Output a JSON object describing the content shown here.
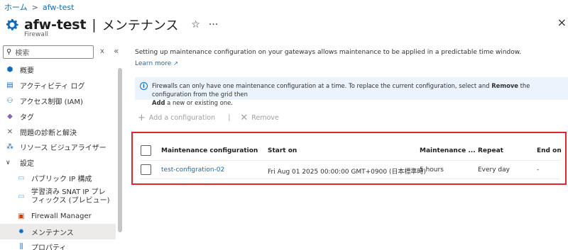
{
  "breadcrumb": {
    "home": "ホーム",
    "current": "afw-test"
  },
  "header": {
    "title": "afw-test",
    "separator": "|",
    "page": "メンテナンス",
    "resource_type": "Firewall",
    "favorite_icon": "☆",
    "more_icon": "···",
    "close_icon": "×"
  },
  "sidebar": {
    "search_placeholder": "検索",
    "clear": "x",
    "collapse": "«",
    "items": [
      {
        "label": "概要",
        "icon": "overview-icon"
      },
      {
        "label": "アクティビティ ログ",
        "icon": "activity-log-icon"
      },
      {
        "label": "アクセス制御 (IAM)",
        "icon": "iam-icon"
      },
      {
        "label": "タグ",
        "icon": "tag-icon"
      },
      {
        "label": "問題の診断と解決",
        "icon": "diagnose-icon"
      },
      {
        "label": "リソース ビジュアライザー",
        "icon": "visualizer-icon"
      },
      {
        "label": "設定",
        "icon": "chevron-down-icon"
      },
      {
        "label": "パブリック IP 構成",
        "icon": "public-ip-icon"
      },
      {
        "label": "学習済み SNAT IP プレフィックス (プレビュー)",
        "icon": "snat-icon"
      },
      {
        "label": "Firewall Manager",
        "icon": "firewall-manager-icon"
      },
      {
        "label": "メンテナンス",
        "icon": "gear-icon"
      },
      {
        "label": "プロパティ",
        "icon": "properties-icon"
      }
    ]
  },
  "main": {
    "description": "Setting up maintenance configuration on your gateways allows maintenance to be applied in a predictable time window.",
    "learn_more": "Learn more",
    "info_line1_pre": "Firewalls can only have one maintenance configuration at a time. To replace the current configuration, select and ",
    "info_remove": "Remove",
    "info_line1_post": " the configuration from the grid then",
    "info_add": "Add",
    "info_line2_post": " a new or existing one.",
    "toolbar": {
      "add_label": "Add a configuration",
      "remove_label": "Remove",
      "divider": "|"
    },
    "table": {
      "headers": [
        "Maintenance configuration",
        "Start on",
        "Maintenance ...",
        "Repeat",
        "End on"
      ],
      "rows": [
        [
          "test-configration-02",
          "Fri Aug 01 2025 00:00:00 GMT+0900 (日本標準時)",
          "5 hours",
          "Every day",
          "-"
        ]
      ]
    }
  },
  "colors": {
    "accent": "#0f6cbd",
    "highlight_border": "#e0262e",
    "info_bg": "#ebf3fc"
  }
}
